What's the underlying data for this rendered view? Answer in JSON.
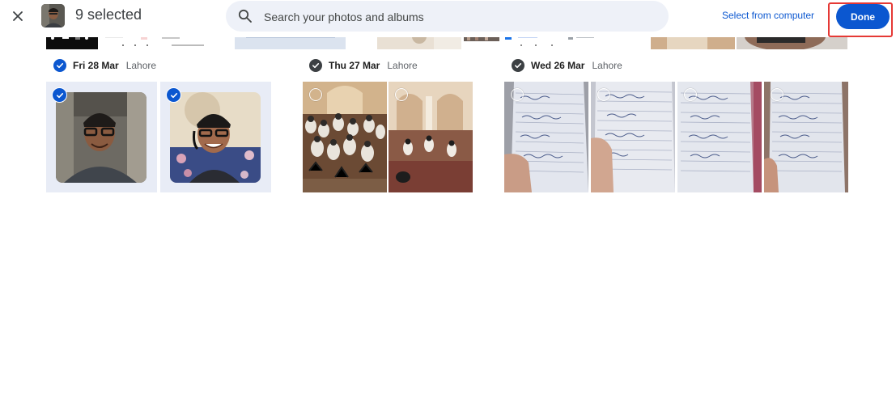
{
  "header": {
    "close_icon": "close-icon",
    "selected_text": "9 selected",
    "search_placeholder": "Search your photos and albums",
    "select_from_computer": "Select from computer",
    "done_label": "Done"
  },
  "groups": [
    {
      "date": "Fri 28 Mar",
      "place": "Lahore",
      "selected": true,
      "photos": [
        {
          "selected": true
        },
        {
          "selected": true
        }
      ]
    },
    {
      "date": "Thu 27 Mar",
      "place": "Lahore",
      "selected": false,
      "photos": [
        {
          "selected": false
        },
        {
          "selected": false
        }
      ]
    },
    {
      "date": "Wed 26 Mar",
      "place": "Lahore",
      "selected": false,
      "photos": [
        {
          "selected": false
        },
        {
          "selected": false
        },
        {
          "selected": false
        },
        {
          "selected": false
        }
      ]
    }
  ],
  "colors": {
    "accent": "#0b57d0",
    "highlight": "#e53935",
    "search_bg": "#eef1f8",
    "selected_tile_bg": "#e8ecf6"
  }
}
